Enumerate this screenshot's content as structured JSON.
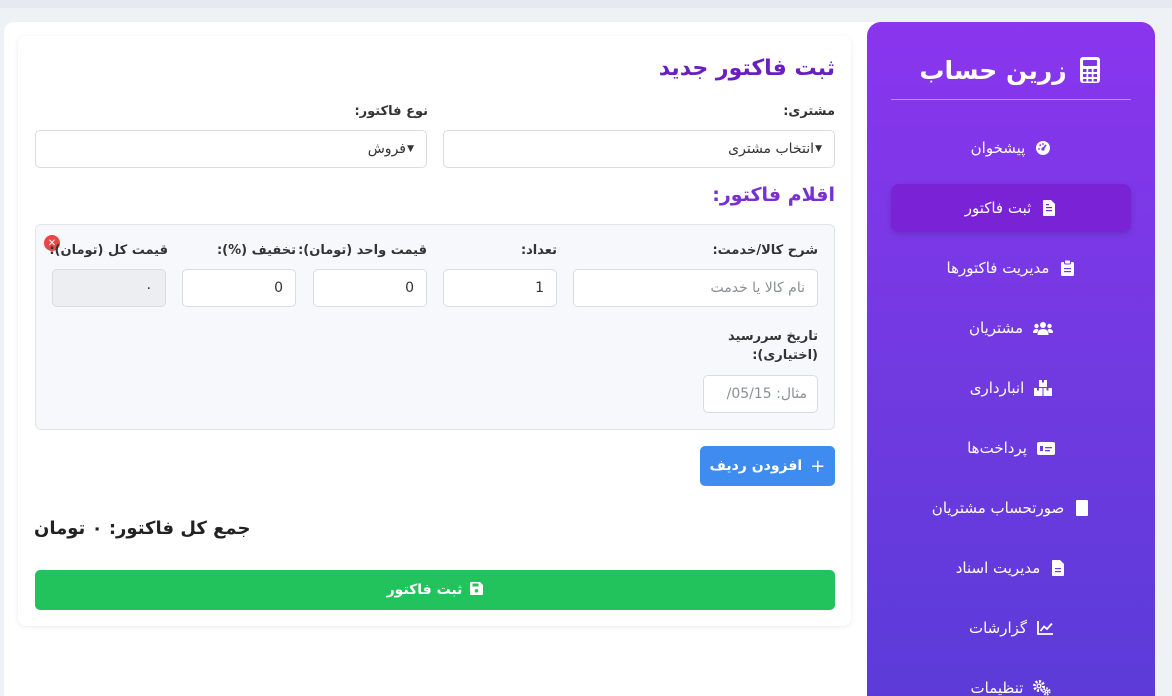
{
  "app": {
    "title": "زرین حساب",
    "logo_icon": "calculator-icon"
  },
  "sidebar": {
    "items": [
      {
        "label": "پیشخوان",
        "icon": "dashboard-icon",
        "active": false
      },
      {
        "label": "ثبت فاکتور",
        "icon": "invoice-icon",
        "active": true
      },
      {
        "label": "مدیریت فاکتورها",
        "icon": "clipboard-icon",
        "active": false
      },
      {
        "label": "مشتریان",
        "icon": "users-icon",
        "active": false
      },
      {
        "label": "انبارداری",
        "icon": "boxes-icon",
        "active": false
      },
      {
        "label": "پرداخت‌ها",
        "icon": "card-icon",
        "active": false
      },
      {
        "label": "صورتحساب مشتریان",
        "icon": "receipt-icon",
        "active": false
      },
      {
        "label": "مدیریت اسناد",
        "icon": "document-icon",
        "active": false
      },
      {
        "label": "گزارشات",
        "icon": "chart-icon",
        "active": false
      },
      {
        "label": "تنظیمات",
        "icon": "gears-icon",
        "active": false
      }
    ]
  },
  "form": {
    "title": "ثبت فاکتور جدید",
    "customer_label": "مشتری:",
    "customer_value": "انتخاب مشتری",
    "type_label": "نوع فاکتور:",
    "type_value": "فروش",
    "items_title": "اقلام فاکتور:",
    "row": {
      "desc_label": "شرح کالا/خدمت:",
      "desc_placeholder": "نام کالا یا خدمت",
      "qty_label": "تعداد:",
      "qty_value": "1",
      "unit_price_label": "قیمت واحد (تومان):",
      "unit_price_value": "0",
      "discount_label": "تخفیف (%):",
      "discount_value": "0",
      "total_label": "قیمت کل (تومان):",
      "total_value": "۰",
      "due_label_1": "تاریخ سررسید",
      "due_label_2": "(اختیاری):",
      "due_placeholder": "مثال: 05/15/"
    },
    "add_row_label": "افزودن ردیف",
    "grand_total": "جمع کل فاکتور: ۰ تومان",
    "submit_label": "ثبت فاکتور"
  }
}
